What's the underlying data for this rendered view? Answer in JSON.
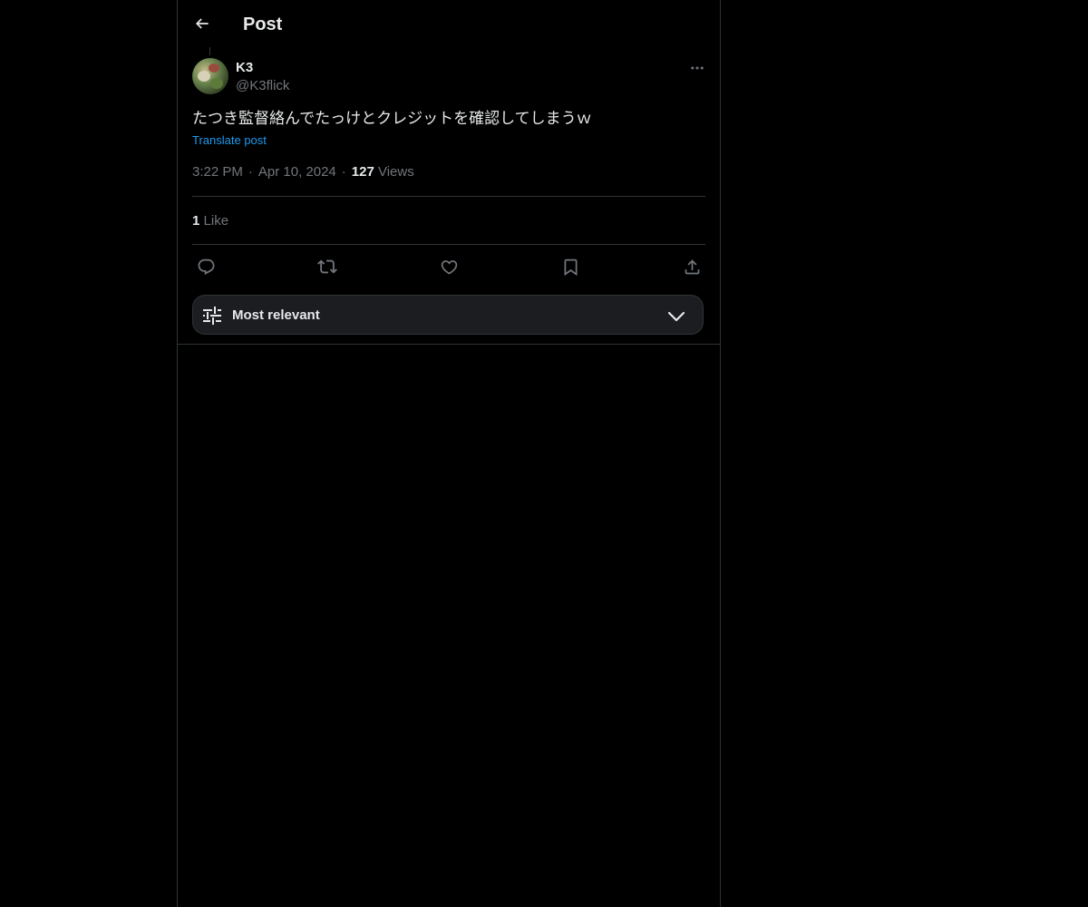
{
  "header": {
    "title": "Post",
    "back_icon": "arrow-left-icon"
  },
  "post": {
    "author": {
      "display_name": "K3",
      "handle": "@K3flick",
      "avatar": "avatar-image"
    },
    "text": "たつき監督絡んでたっけとクレジットを確認してしまうｗ",
    "translate_label": "Translate post",
    "time": "3:22 PM",
    "date": "Apr 10, 2024",
    "views_count": "127",
    "views_label": "Views",
    "likes_count": "1",
    "likes_label": "Like"
  },
  "actions": {
    "icons": [
      "reply-icon",
      "repost-icon",
      "like-icon",
      "bookmark-icon",
      "share-icon"
    ]
  },
  "replies_sort": {
    "label": "Most relevant",
    "icon": "sliders-icon",
    "chevron": "chevron-down-icon"
  },
  "colors": {
    "background": "#000000",
    "text_primary": "#e7e9ea",
    "text_secondary": "#71767b",
    "accent": "#1d9bf0",
    "border": "#2f3336"
  }
}
